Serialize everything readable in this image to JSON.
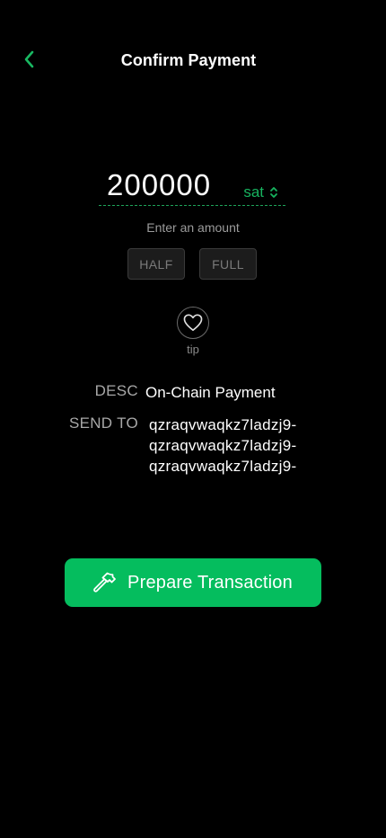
{
  "header": {
    "title": "Confirm Payment",
    "back_icon": "chevron-left-icon"
  },
  "amount": {
    "value": "200000",
    "unit": "sat",
    "unit_toggle_icon": "chevron-up-down-icon",
    "hint": "Enter an amount"
  },
  "quick_actions": {
    "half_label": "HALF",
    "full_label": "FULL"
  },
  "tip": {
    "icon": "heart-icon",
    "label": "tip"
  },
  "details": {
    "desc_label": "DESC",
    "desc_value": "On-Chain Payment",
    "send_to_label": "SEND TO",
    "address_lines": [
      "qzraqvwaqkz7ladzj9-",
      "qzraqvwaqkz7ladzj9-",
      "qzraqvwaqkz7ladzj9-"
    ]
  },
  "primary_action": {
    "label": "Prepare Transaction",
    "icon": "hammer-icon"
  },
  "colors": {
    "background": "#000000",
    "accent": "#05bd5e",
    "accent_text": "#17b35f",
    "muted_text": "#a8a8a8"
  }
}
